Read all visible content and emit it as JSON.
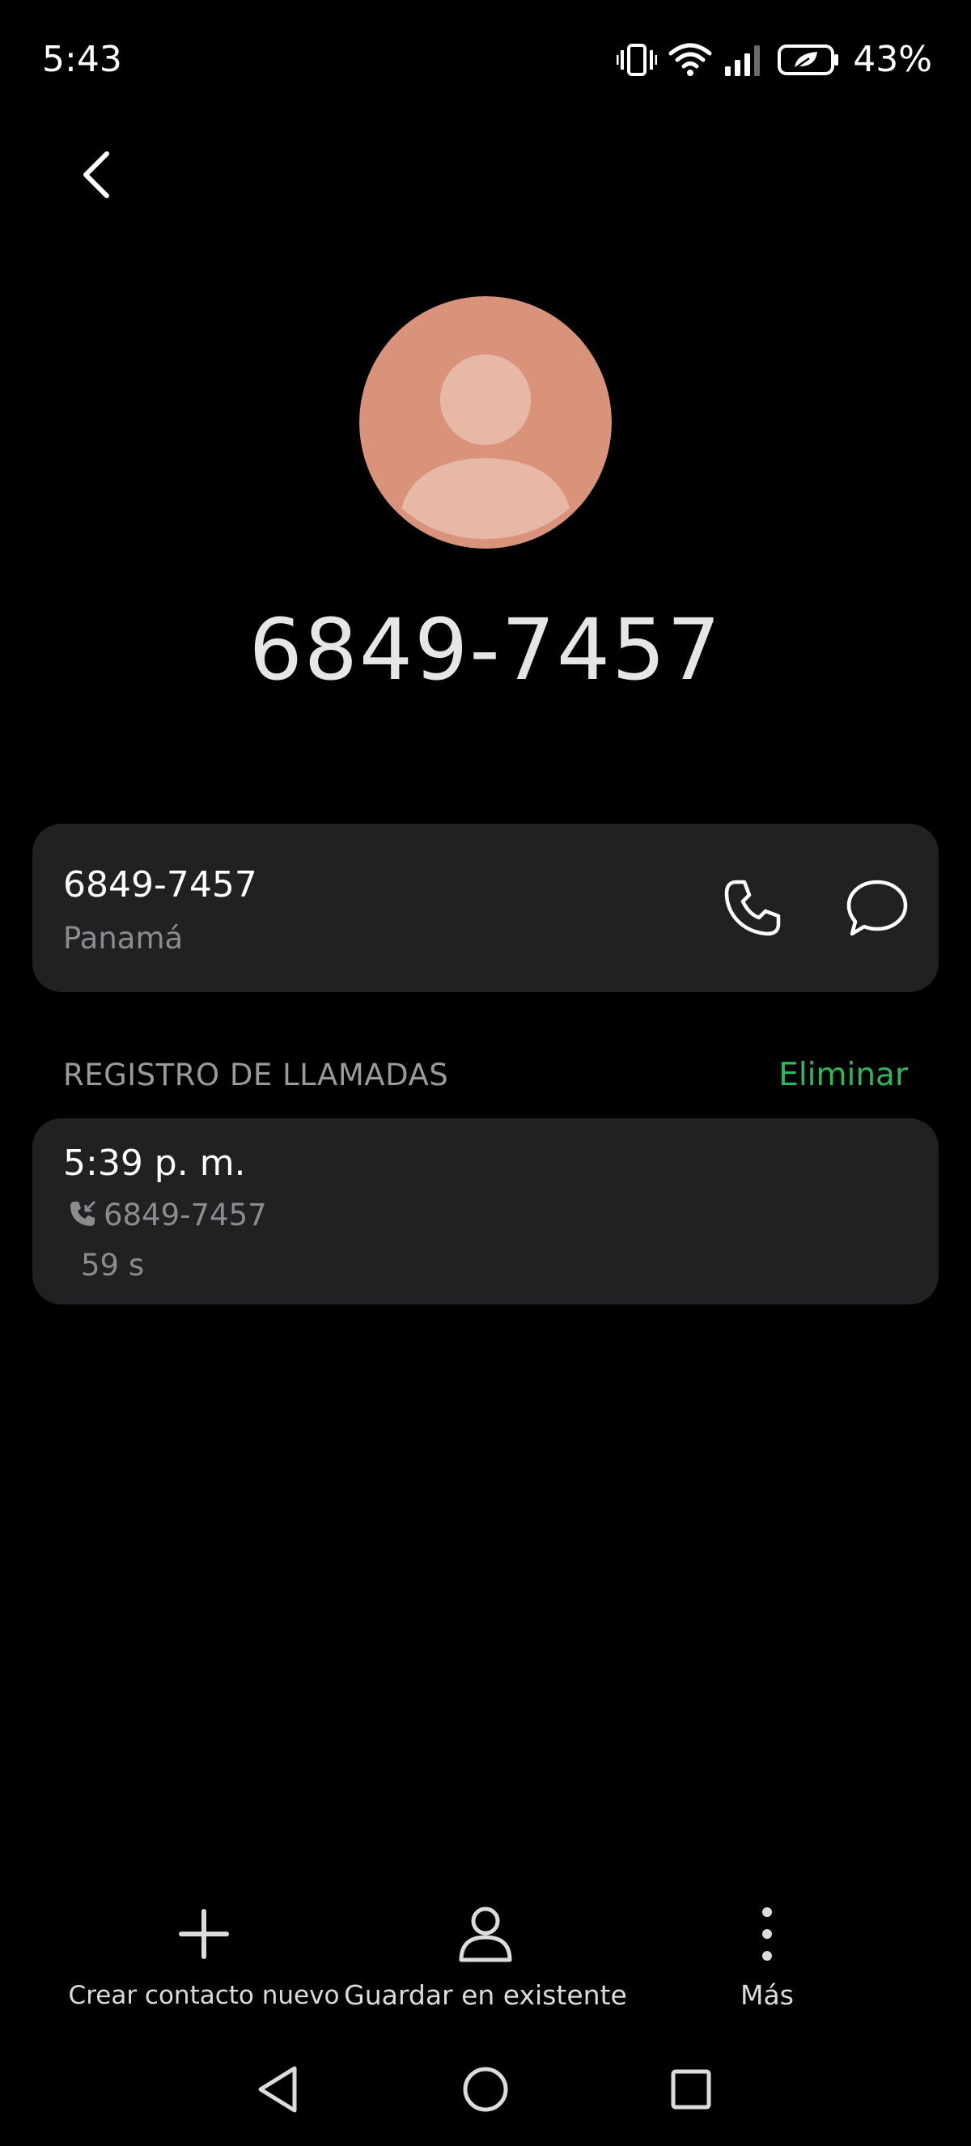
{
  "status_bar": {
    "time": "5:43",
    "battery": "43%",
    "icons": [
      "vibrate-icon",
      "wifi-icon",
      "signal-icon",
      "battery-saver-icon"
    ]
  },
  "header": {
    "back_icon": "chevron-left-icon",
    "avatar_icon": "person-avatar-icon",
    "avatar_color": "#d9937a",
    "number": "6849-7457"
  },
  "phone_card": {
    "number": "6849-7457",
    "region": "Panamá",
    "call_icon": "phone-icon",
    "message_icon": "chat-bubble-icon"
  },
  "call_log": {
    "title": "REGISTRO DE LLAMADAS",
    "delete_label": "Eliminar",
    "accent_color": "#2fb760",
    "entries": [
      {
        "time": "5:39 p. m.",
        "direction_icon": "incoming-call-icon",
        "number": "6849-7457",
        "duration": "59 s"
      }
    ]
  },
  "actions": {
    "create": {
      "label": "Crear contacto nuevo",
      "icon": "plus-icon"
    },
    "save_existing": {
      "label": "Guardar en existente",
      "icon": "person-outline-icon"
    },
    "more": {
      "label": "Más",
      "icon": "more-vertical-icon"
    }
  },
  "nav_bar": {
    "back": "triangle-back-icon",
    "home": "circle-home-icon",
    "recents": "square-recents-icon"
  },
  "colors": {
    "background": "#000000",
    "card": "#212124"
  }
}
